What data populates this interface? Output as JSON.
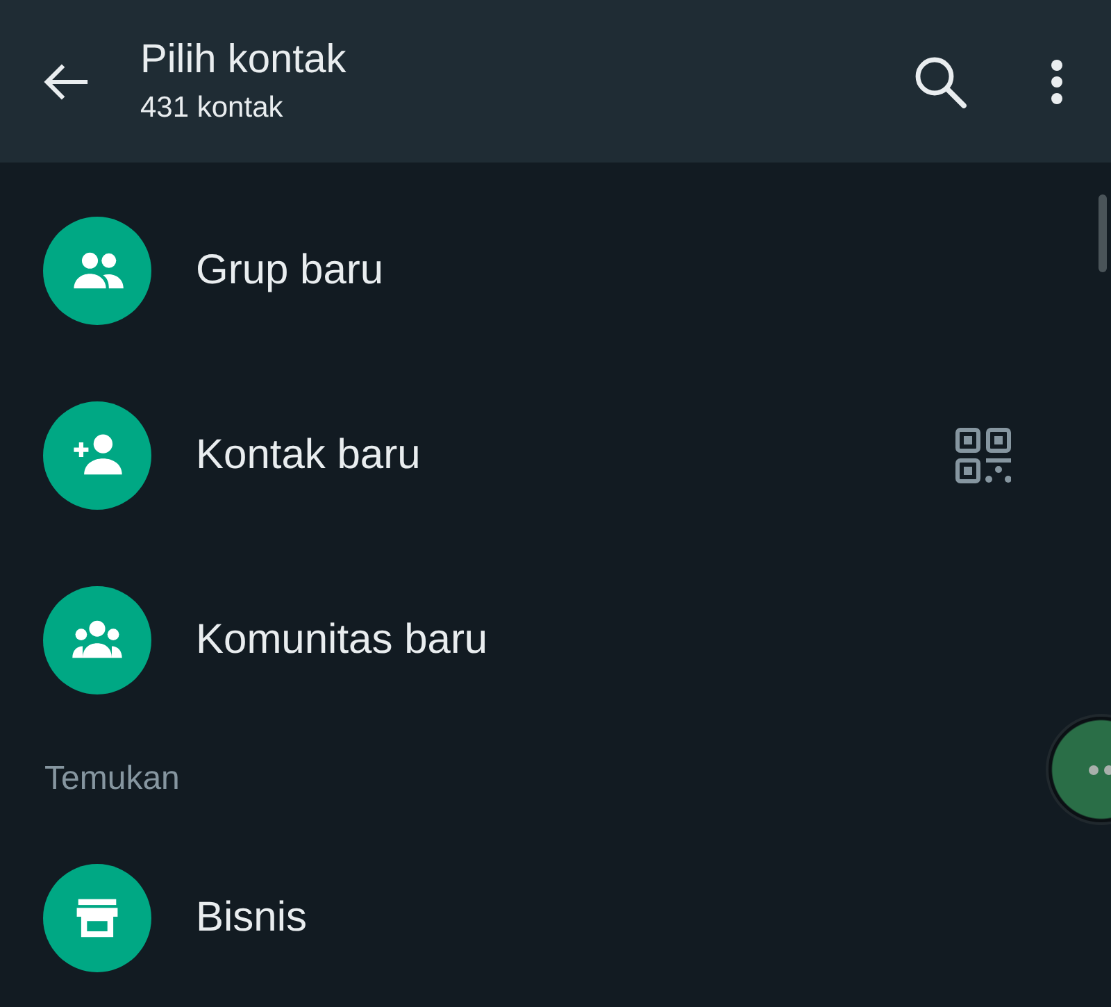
{
  "header": {
    "title": "Pilih kontak",
    "subtitle": "431 kontak"
  },
  "items": [
    {
      "kind": "group",
      "label": "Grup baru",
      "qr": false
    },
    {
      "kind": "contact",
      "label": "Kontak baru",
      "qr": true
    },
    {
      "kind": "community",
      "label": "Komunitas baru",
      "qr": false
    }
  ],
  "sections": [
    {
      "title": "Temukan",
      "items": [
        {
          "kind": "business",
          "label": "Bisnis",
          "qr": false
        }
      ]
    }
  ]
}
